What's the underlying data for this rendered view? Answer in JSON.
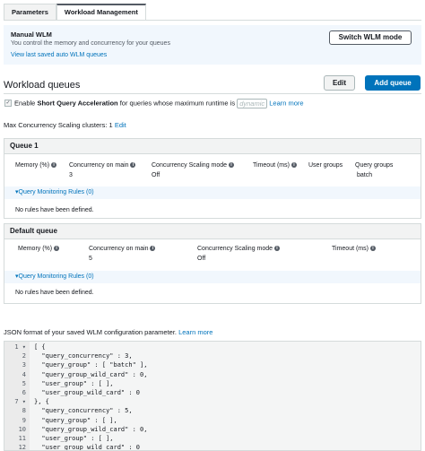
{
  "tabs": [
    {
      "label": "Parameters"
    },
    {
      "label": "Workload Management"
    }
  ],
  "info_panel": {
    "title": "Manual WLM",
    "description": "You control the memory and concurrency for your queues",
    "link": "View last saved auto WLM queues",
    "switch_button": "Switch WLM mode"
  },
  "workload_queues": {
    "title": "Workload queues",
    "edit_button": "Edit",
    "add_button": "Add queue"
  },
  "sqa": {
    "prefix": "Enable",
    "bold": "Short Query Acceleration",
    "suffix": "for queries whose maximum runtime is",
    "dropdown": "dynamic",
    "learn_more": "Learn more"
  },
  "max_concurrency": {
    "label": "Max Concurrency Scaling clusters: 1",
    "edit": "Edit"
  },
  "queue1": {
    "title": "Queue 1",
    "headers": {
      "memory": "Memory (%)",
      "concurrency": "Concurrency on main",
      "scaling": "Concurrency Scaling mode",
      "timeout": "Timeout (ms)",
      "user_groups": "User groups",
      "query_groups": "Query groups"
    },
    "values": {
      "concurrency": "3",
      "scaling": "Off",
      "query_groups": "batch"
    },
    "qmr": "Query Monitoring Rules (0)",
    "no_rules": "No rules have been defined."
  },
  "default_queue": {
    "title": "Default queue",
    "headers": {
      "memory": "Memory (%)",
      "concurrency": "Concurrency on main",
      "scaling": "Concurrency Scaling mode",
      "timeout": "Timeout (ms)"
    },
    "values": {
      "concurrency": "5",
      "scaling": "Off"
    },
    "qmr": "Query Monitoring Rules (0)",
    "no_rules": "No rules have been defined."
  },
  "json_section": {
    "label": "JSON format of your saved WLM configuration parameter.",
    "learn_more": "Learn more"
  },
  "code_lines": [
    {
      "n": "1",
      "text": "[ {"
    },
    {
      "n": "2",
      "text": "  \"query_concurrency\" : 3,"
    },
    {
      "n": "3",
      "text": "  \"query_group\" : [ \"batch\" ],"
    },
    {
      "n": "4",
      "text": "  \"query_group_wild_card\" : 0,"
    },
    {
      "n": "5",
      "text": "  \"user_group\" : [ ],"
    },
    {
      "n": "6",
      "text": "  \"user_group_wild_card\" : 0"
    },
    {
      "n": "7",
      "text": "}, {"
    },
    {
      "n": "8",
      "text": "  \"query_concurrency\" : 5,"
    },
    {
      "n": "9",
      "text": "  \"query_group\" : [ ],"
    },
    {
      "n": "10",
      "text": "  \"query_group_wild_card\" : 0,"
    },
    {
      "n": "11",
      "text": "  \"user_group\" : [ ],"
    },
    {
      "n": "12",
      "text": "  \"user_group_wild_card\" : 0"
    }
  ],
  "colors": {
    "link": "#0073bb",
    "primary": "#0073bb",
    "info_bg": "#f1f7fd"
  }
}
